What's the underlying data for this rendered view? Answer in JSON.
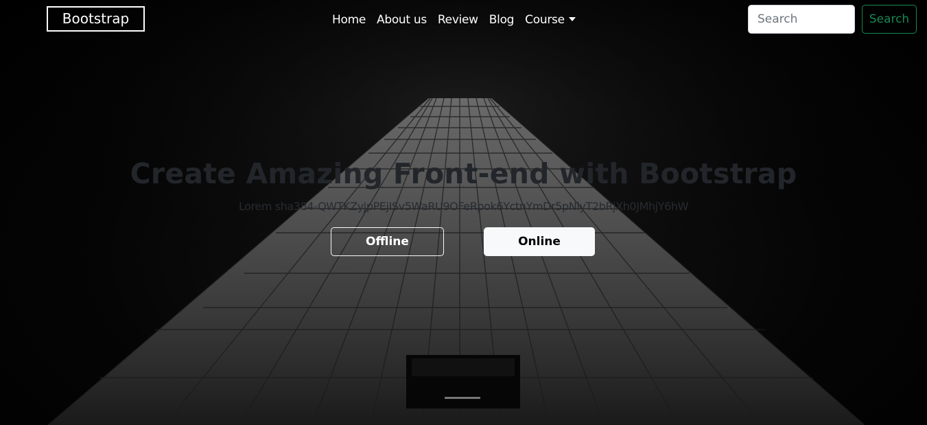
{
  "navbar": {
    "brand": "Bootstrap",
    "links": [
      "Home",
      "About us",
      "Review",
      "Blog"
    ],
    "dropdown_label": "Course",
    "search_placeholder": "Search",
    "search_button": "Search"
  },
  "hero": {
    "title": "Create Amazing Front-end with Bootstrap",
    "subtitle": "Lorem sha384-QWTKZyjpPEjISv5WaRU9OFeRpok6YctnYmDr5pNlyT2bRjXh0JMhjY6hW",
    "buttons": {
      "offline": "Offline",
      "online": "Online"
    }
  },
  "colors": {
    "background": "#000000",
    "search_button_accent": "#198754",
    "online_button_bg": "#f8f9fa",
    "headline_text": "#22262b"
  },
  "icons": {
    "dropdown": "caret-down-icon"
  }
}
